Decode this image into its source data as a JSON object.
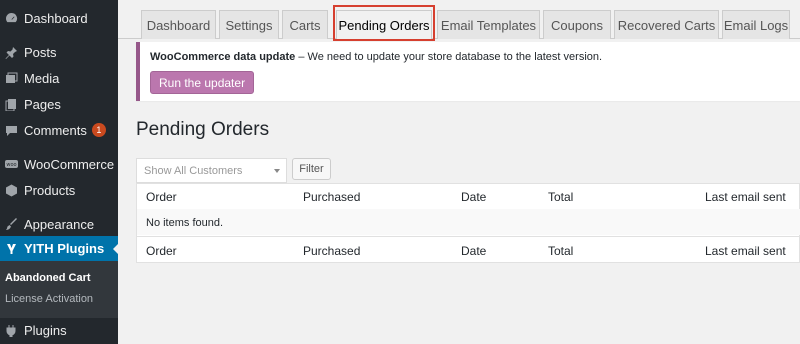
{
  "sidebar": {
    "items": [
      {
        "label": "Dashboard",
        "icon": "dashboard-icon"
      },
      {
        "label": "Posts",
        "icon": "pin-icon"
      },
      {
        "label": "Media",
        "icon": "media-icon"
      },
      {
        "label": "Pages",
        "icon": "pages-icon"
      },
      {
        "label": "Comments",
        "icon": "comment-icon",
        "badge": "1"
      },
      {
        "label": "WooCommerce",
        "icon": "woocommerce-icon"
      },
      {
        "label": "Products",
        "icon": "box-icon"
      },
      {
        "label": "Appearance",
        "icon": "brush-icon"
      },
      {
        "label": "YITH Plugins",
        "icon": "yith-icon"
      },
      {
        "label": "Plugins",
        "icon": "plug-icon"
      }
    ],
    "submenu": [
      {
        "label": "Abandoned Cart"
      },
      {
        "label": "License Activation"
      }
    ]
  },
  "tabs": [
    {
      "label": "Dashboard"
    },
    {
      "label": "Settings"
    },
    {
      "label": "Carts"
    },
    {
      "label": "Pending Orders"
    },
    {
      "label": "Email Templates"
    },
    {
      "label": "Coupons"
    },
    {
      "label": "Recovered Carts"
    },
    {
      "label": "Email Logs"
    }
  ],
  "notice": {
    "title": "WooCommerce data update",
    "message": " – We need to update your store database to the latest version.",
    "button_label": "Run the updater"
  },
  "page": {
    "title": "Pending Orders"
  },
  "filters": {
    "customer_select_value": "Show All Customers",
    "filter_button_label": "Filter"
  },
  "table": {
    "columns": [
      "Order",
      "Purchased",
      "Date",
      "Total",
      "Last email sent"
    ],
    "empty_message": "No items found."
  },
  "colors": {
    "sidebar_bg": "#23282d",
    "active_menu": "#0073aa",
    "notice_border": "#96588a",
    "updater_button": "#bb77ae",
    "highlight": "#d63f2f"
  }
}
